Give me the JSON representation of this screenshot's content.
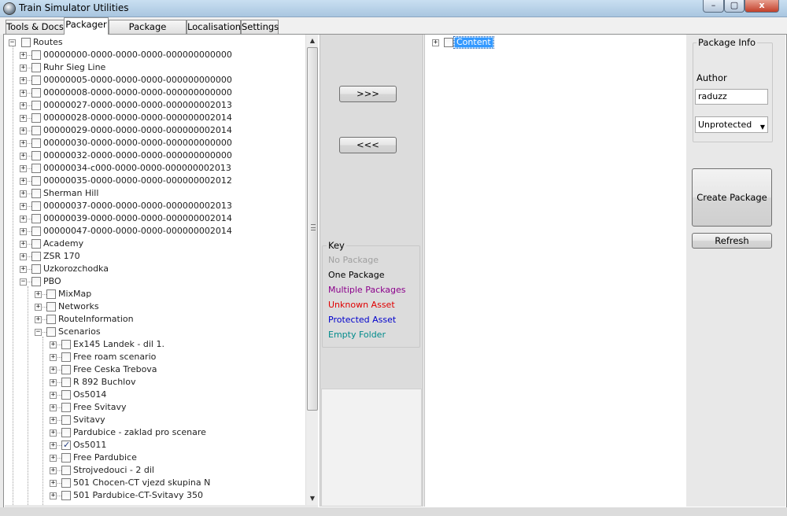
{
  "window": {
    "title": "Train Simulator Utilities",
    "minimize_label": "–",
    "maximize_label": "▢",
    "close_label": "x"
  },
  "tabs": [
    {
      "label": "Tools & Docs"
    },
    {
      "label": "Packager"
    },
    {
      "label": "Package Manager"
    },
    {
      "label": "Localisation"
    },
    {
      "label": "Settings"
    }
  ],
  "active_tab": "Packager",
  "tree": {
    "root": "Routes",
    "items": [
      {
        "label": "00000000-0000-0000-0000-000000000000",
        "level": 1,
        "checked": false
      },
      {
        "label": "Ruhr Sieg Line",
        "level": 1,
        "checked": false
      },
      {
        "label": "00000005-0000-0000-0000-000000000000",
        "level": 1,
        "checked": false
      },
      {
        "label": "00000008-0000-0000-0000-000000000000",
        "level": 1,
        "checked": false
      },
      {
        "label": "00000027-0000-0000-0000-000000002013",
        "level": 1,
        "checked": false
      },
      {
        "label": "00000028-0000-0000-0000-000000002014",
        "level": 1,
        "checked": false
      },
      {
        "label": "00000029-0000-0000-0000-000000002014",
        "level": 1,
        "checked": false
      },
      {
        "label": "00000030-0000-0000-0000-000000000000",
        "level": 1,
        "checked": false
      },
      {
        "label": "00000032-0000-0000-0000-000000000000",
        "level": 1,
        "checked": false
      },
      {
        "label": "00000034-c000-0000-0000-000000002013",
        "level": 1,
        "checked": false
      },
      {
        "label": "00000035-0000-0000-0000-000000002012",
        "level": 1,
        "checked": false
      },
      {
        "label": "Sherman Hill",
        "level": 1,
        "checked": false
      },
      {
        "label": "00000037-0000-0000-0000-000000002013",
        "level": 1,
        "checked": false
      },
      {
        "label": "00000039-0000-0000-0000-000000002014",
        "level": 1,
        "checked": false
      },
      {
        "label": "00000047-0000-0000-0000-000000002014",
        "level": 1,
        "checked": false
      },
      {
        "label": "Academy",
        "level": 1,
        "checked": false
      },
      {
        "label": "ZSR 170",
        "level": 1,
        "checked": false
      },
      {
        "label": "Uzkorozchodka",
        "level": 1,
        "checked": false
      },
      {
        "label": "PBO",
        "level": 1,
        "checked": false,
        "expanded": true
      },
      {
        "label": "MixMap",
        "level": 2,
        "checked": false
      },
      {
        "label": "Networks",
        "level": 2,
        "checked": false
      },
      {
        "label": "RouteInformation",
        "level": 2,
        "checked": false
      },
      {
        "label": "Scenarios",
        "level": 2,
        "checked": false,
        "expanded": true
      },
      {
        "label": "Ex145 Landek - dil 1.",
        "level": 3,
        "checked": false
      },
      {
        "label": "Free roam scenario",
        "level": 3,
        "checked": false
      },
      {
        "label": "Free Ceska Trebova",
        "level": 3,
        "checked": false
      },
      {
        "label": "R 892 Buchlov",
        "level": 3,
        "checked": false
      },
      {
        "label": "Os5014",
        "level": 3,
        "checked": false
      },
      {
        "label": "Free Svitavy",
        "level": 3,
        "checked": false
      },
      {
        "label": "Svitavy",
        "level": 3,
        "checked": false
      },
      {
        "label": "Pardubice - zaklad pro scenare",
        "level": 3,
        "checked": false
      },
      {
        "label": "Os5011",
        "level": 3,
        "checked": true
      },
      {
        "label": "Free Pardubice",
        "level": 3,
        "checked": false
      },
      {
        "label": "Strojvedouci - 2 dil",
        "level": 3,
        "checked": false
      },
      {
        "label": "501 Chocen-CT vjezd skupina N",
        "level": 3,
        "checked": false
      },
      {
        "label": "501 Pardubice-CT-Svitavy 350",
        "level": 3,
        "checked": false
      }
    ]
  },
  "buttons": {
    "add_label": ">>>",
    "remove_label": "<<<",
    "create_package_label": "Create Package",
    "refresh_label": "Refresh"
  },
  "key": {
    "title": "Key",
    "items": [
      {
        "label": "No Package",
        "color": "#a0a0a0"
      },
      {
        "label": "One Package",
        "color": "#000000"
      },
      {
        "label": "Multiple Packages",
        "color": "#8b008b"
      },
      {
        "label": "Unknown Asset",
        "color": "#e00000"
      },
      {
        "label": "Protected Asset",
        "color": "#0000cc"
      },
      {
        "label": "Empty Folder",
        "color": "#008b8b"
      }
    ]
  },
  "content_tree": {
    "root": "Content"
  },
  "package_info": {
    "title": "Package Info",
    "author_label": "Author",
    "author_value": "raduzz",
    "protection_value": "Unprotected"
  }
}
